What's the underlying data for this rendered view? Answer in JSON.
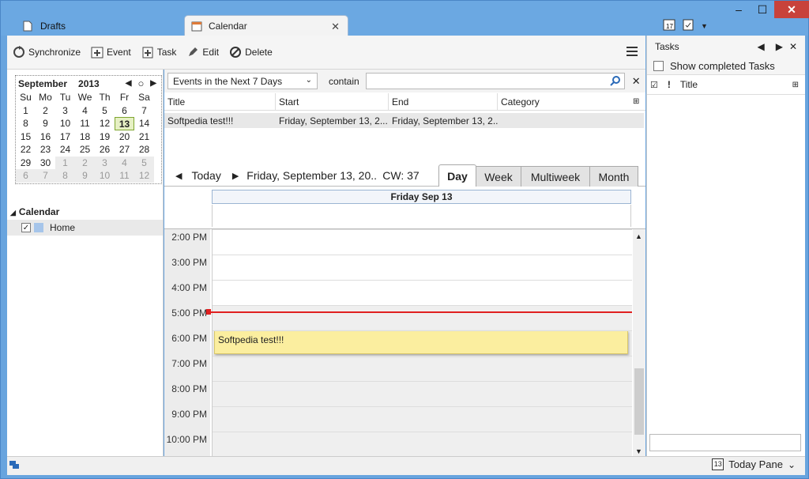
{
  "tabs": [
    {
      "label": "Drafts",
      "active": false
    },
    {
      "label": "Calendar",
      "active": true
    }
  ],
  "window": {
    "min": "–",
    "max": "☐",
    "close": "✕"
  },
  "toolbar": {
    "synchronize": "Synchronize",
    "event": "Event",
    "task": "Task",
    "edit": "Edit",
    "delete": "Delete"
  },
  "minical": {
    "month": "September",
    "year": "2013",
    "dow": [
      "Su",
      "Mo",
      "Tu",
      "We",
      "Th",
      "Fr",
      "Sa"
    ],
    "days": [
      [
        "1",
        "2",
        "3",
        "4",
        "5",
        "6",
        "7"
      ],
      [
        "8",
        "9",
        "10",
        "11",
        "12",
        "13",
        "14"
      ],
      [
        "15",
        "16",
        "17",
        "18",
        "19",
        "20",
        "21"
      ],
      [
        "22",
        "23",
        "24",
        "25",
        "26",
        "27",
        "28"
      ],
      [
        "29",
        "30",
        "1",
        "2",
        "3",
        "4",
        "5"
      ],
      [
        "6",
        "7",
        "8",
        "9",
        "10",
        "11",
        "12"
      ]
    ],
    "today": "13"
  },
  "calendars": {
    "header": "Calendar",
    "items": [
      {
        "name": "Home",
        "checked": true,
        "color": "#a6c5ea"
      }
    ]
  },
  "filter": {
    "select": "Events in the Next 7 Days",
    "contain_label": "contain",
    "search_value": ""
  },
  "list": {
    "columns": [
      "Title",
      "Start",
      "End",
      "Category"
    ],
    "rows": [
      [
        "Softpedia test!!!",
        "Friday, September 13, 2...",
        "Friday, September 13, 2...",
        ""
      ]
    ]
  },
  "nav": {
    "today": "Today",
    "date": "Friday, September 13, 20...",
    "cw": "CW: 37"
  },
  "views": [
    "Day",
    "Week",
    "Multiweek",
    "Month"
  ],
  "day": {
    "header": "Friday Sep 13",
    "times": [
      "2:00 PM",
      "3:00 PM",
      "4:00 PM",
      "5:00 PM",
      "6:00 PM",
      "7:00 PM",
      "8:00 PM",
      "9:00 PM",
      "10:00 PM"
    ],
    "event": "Softpedia test!!!"
  },
  "tasks": {
    "title": "Tasks",
    "show_completed": "Show completed Tasks",
    "col_title": "Title",
    "input_value": ""
  },
  "status": {
    "today_pane": "Today Pane",
    "today_num": "13"
  },
  "colors": {
    "accent": "#68a4de",
    "event": "#fbee9f",
    "now": "#e02020",
    "today_bg": "#e6f0c4"
  }
}
